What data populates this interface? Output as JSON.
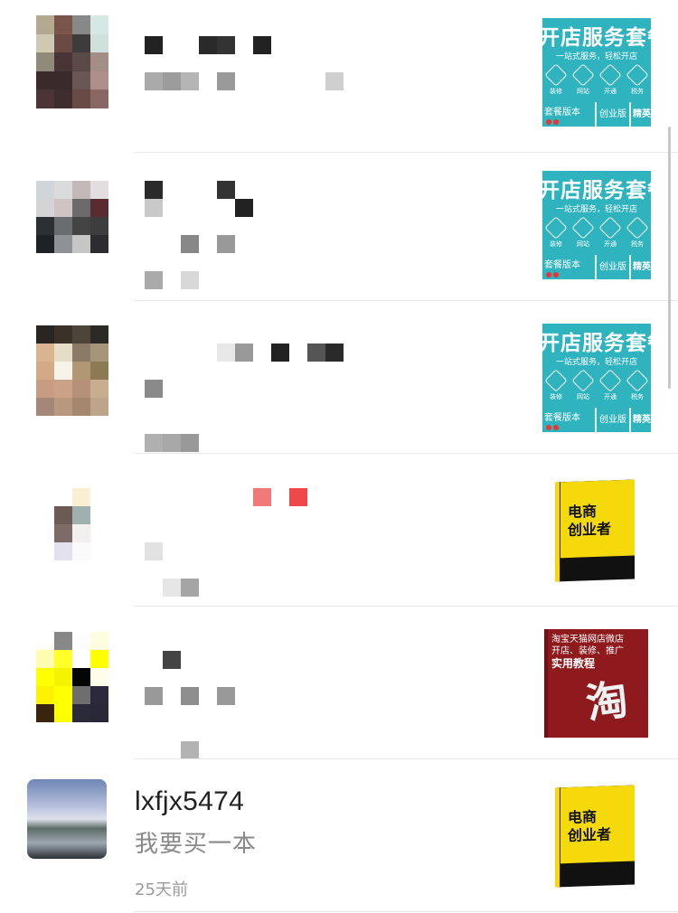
{
  "conversations": [
    {
      "id": "row-1",
      "thumbnail": {
        "type": "shop-banner",
        "title": "开店服务套餐",
        "subtitle": "一站式服务，轻松开店",
        "labels": [
          "装修",
          "网站",
          "开通",
          "税务"
        ],
        "bar_left": "套餐版本",
        "bar_mid": "创业版",
        "bar_right": "精英"
      }
    },
    {
      "id": "row-2",
      "thumbnail": {
        "type": "shop-banner",
        "title": "开店服务套餐",
        "subtitle": "一站式服务，轻松开店",
        "labels": [
          "装修",
          "网站",
          "开通",
          "税务"
        ],
        "bar_left": "套餐版本",
        "bar_mid": "创业版",
        "bar_right": "精英"
      }
    },
    {
      "id": "row-3",
      "thumbnail": {
        "type": "shop-banner",
        "title": "开店服务套餐",
        "subtitle": "一站式服务，轻松开店",
        "labels": [
          "装修",
          "网站",
          "开通",
          "税务"
        ],
        "bar_left": "套餐版本",
        "bar_mid": "创业版",
        "bar_right": "精英"
      }
    },
    {
      "id": "row-4",
      "thumbnail": {
        "type": "book-yellow",
        "title_line1": "电商",
        "title_line2": "创业者"
      }
    },
    {
      "id": "row-5",
      "thumbnail": {
        "type": "book-red",
        "line1": "淘宝天猫网店微店",
        "line2": "开店、装修、推广",
        "line3": "实用教程",
        "big": "淘"
      }
    },
    {
      "id": "row-6",
      "name": "lxfjx5474",
      "message": "我要买一本",
      "time": "25天前",
      "thumbnail": {
        "type": "book-yellow",
        "title_line1": "电商",
        "title_line2": "创业者"
      }
    }
  ],
  "colors": {
    "accent_teal": "#2fb3be",
    "text_primary": "#222222",
    "text_secondary": "#8a8a8a",
    "divider": "#e8e8e8"
  }
}
